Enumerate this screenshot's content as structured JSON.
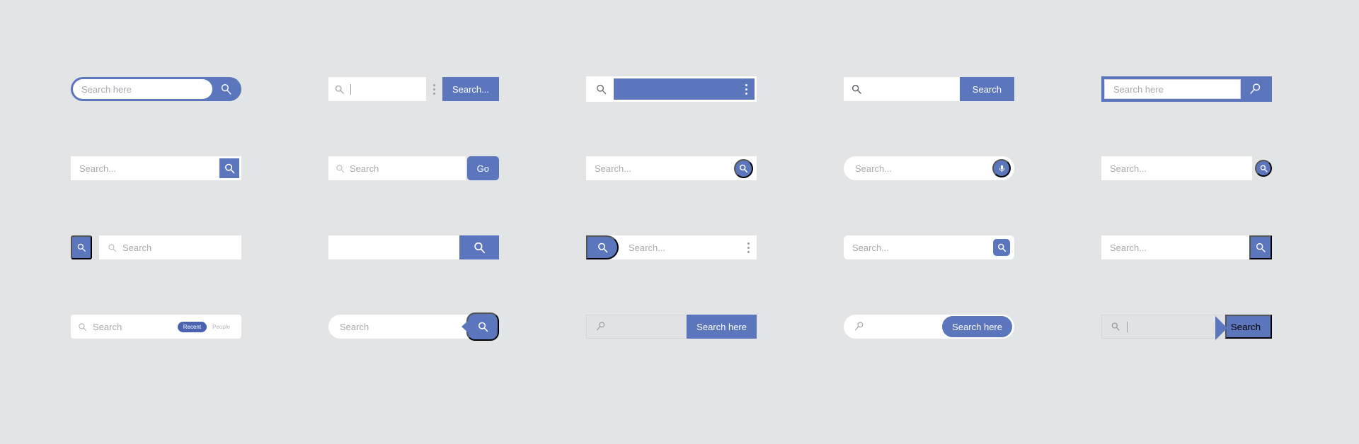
{
  "page": {
    "background": "#e3e4e6",
    "accent": "#5b76bc",
    "accent_dark": "#4a62b0",
    "field_bg": "#ffffff",
    "placeholder_color": "#a7aab0",
    "grey_field_bg": "#e1e2e5"
  },
  "variants": [
    {
      "id": 1,
      "name": "pill-outline-search-bar",
      "placeholder": "Search here",
      "value": "",
      "button_label": "",
      "icon": "magnifier-icon"
    },
    {
      "id": 2,
      "name": "search-bar-with-label-button",
      "placeholder": "",
      "value": "",
      "button_label": "Search...",
      "icon": "magnifier-icon",
      "overflow_icon": "vertical-dots-icon"
    },
    {
      "id": 3,
      "name": "filled-blue-field-search-bar",
      "placeholder": "",
      "value": "",
      "button_label": "",
      "icon": "magnifier-icon",
      "overflow_icon": "vertical-dots-icon"
    },
    {
      "id": 4,
      "name": "basic-search-bar",
      "placeholder": "",
      "value": "",
      "button_label": "Search",
      "icon": "magnifier-icon"
    },
    {
      "id": 5,
      "name": "blue-framed-search-bar",
      "placeholder": "Search here",
      "value": "",
      "button_label": "",
      "icon": "magnifier-key-icon"
    },
    {
      "id": 6,
      "name": "square-icon-button-search-bar",
      "placeholder": "Search...",
      "value": "",
      "button_label": "",
      "icon": "magnifier-icon"
    },
    {
      "id": 7,
      "name": "go-button-search-bar",
      "placeholder": "Search",
      "value": "",
      "button_label": "Go",
      "icon": "magnifier-icon"
    },
    {
      "id": 8,
      "name": "circular-icon-search-bar",
      "placeholder": "Search...",
      "value": "",
      "button_label": "",
      "icon": "magnifier-icon"
    },
    {
      "id": 9,
      "name": "voice-search-bar",
      "placeholder": "Search...",
      "value": "",
      "button_label": "",
      "icon": "microphone-icon"
    },
    {
      "id": 10,
      "name": "flat-search-bar-with-circle-button",
      "placeholder": "Search...",
      "value": "",
      "button_label": "",
      "icon": "magnifier-icon"
    },
    {
      "id": 11,
      "name": "detached-left-button-search-bar",
      "placeholder": "Search",
      "value": "",
      "button_label": "",
      "icon": "magnifier-icon"
    },
    {
      "id": 12,
      "name": "empty-field-search-bar",
      "placeholder": "",
      "value": "",
      "button_label": "",
      "icon": "magnifier-icon"
    },
    {
      "id": 13,
      "name": "left-pill-button-search-bar",
      "placeholder": "Search...",
      "value": "",
      "button_label": "",
      "icon": "magnifier-icon",
      "overflow_icon": "vertical-dots-icon"
    },
    {
      "id": 14,
      "name": "rounded-square-button-search-bar",
      "placeholder": "Search...",
      "value": "",
      "button_label": "",
      "icon": "magnifier-icon"
    },
    {
      "id": 15,
      "name": "square-right-button-search-bar",
      "placeholder": "Search...",
      "value": "",
      "button_label": "",
      "icon": "magnifier-icon"
    },
    {
      "id": 16,
      "name": "filter-chips-search-bar",
      "placeholder": "Search",
      "value": "",
      "button_label": "",
      "icon": "magnifier-icon",
      "chips": [
        {
          "label": "Recent",
          "active": true
        },
        {
          "label": "People",
          "active": false
        }
      ]
    },
    {
      "id": 17,
      "name": "notch-button-search-bar",
      "placeholder": "Search",
      "value": "",
      "button_label": "",
      "icon": "magnifier-icon"
    },
    {
      "id": 18,
      "name": "grey-field-search-bar",
      "placeholder": "",
      "value": "",
      "button_label": "Search here",
      "icon": "magnifier-key-icon"
    },
    {
      "id": 19,
      "name": "rounded-search-here-bar",
      "placeholder": "",
      "value": "",
      "button_label": "Search here",
      "icon": "magnifier-key-icon"
    },
    {
      "id": 20,
      "name": "chevron-button-search-bar",
      "placeholder": "",
      "value": "",
      "button_label": "Search",
      "icon": "magnifier-icon"
    }
  ]
}
